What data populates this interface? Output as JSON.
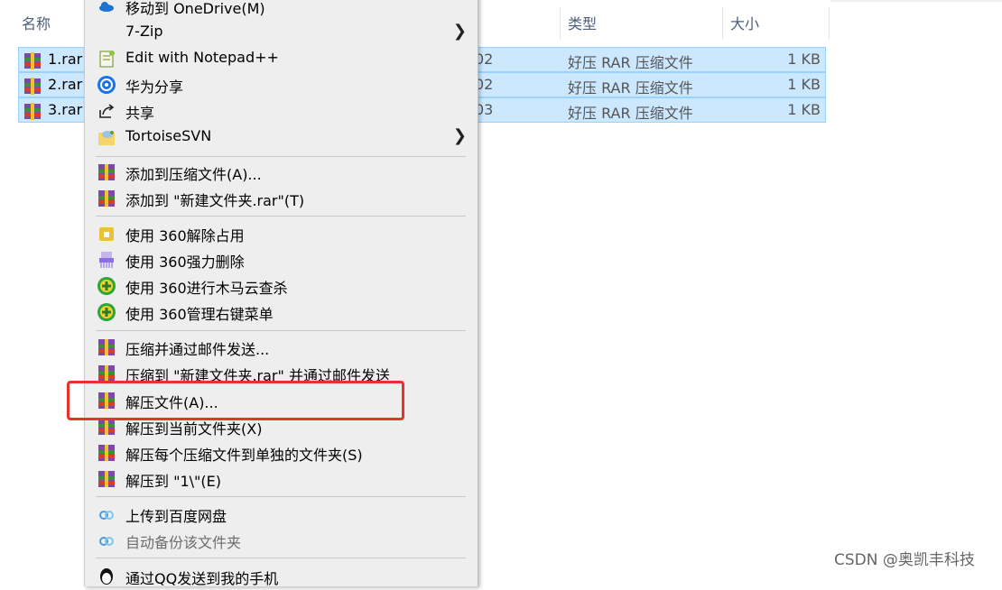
{
  "explorer": {
    "columns": {
      "name": "名称",
      "type": "类型",
      "size": "大小"
    },
    "files": [
      {
        "name": "1.rar",
        "date_fragment": "02",
        "type": "好压 RAR 压缩文件",
        "size": "1 KB"
      },
      {
        "name": "2.rar",
        "date_fragment": "02",
        "type": "好压 RAR 压缩文件",
        "size": "1 KB"
      },
      {
        "name": "3.rar",
        "date_fragment": "03",
        "type": "好压 RAR 压缩文件",
        "size": "1 KB"
      }
    ]
  },
  "context_menu": {
    "onedrive": "移动到 OneDrive(M)",
    "sevenzip": "7-Zip",
    "notepadpp": "Edit with Notepad++",
    "huawei_share": "华为分享",
    "share": "共享",
    "tortoisesvn": "TortoiseSVN",
    "add_archive": "添加到压缩文件(A)...",
    "add_to_named": "添加到 \"新建文件夹.rar\"(T)",
    "unlock_360": "使用 360解除占用",
    "force_delete_360": "使用 360强力删除",
    "trojan_scan_360": "使用 360进行木马云查杀",
    "manage_menu_360": "使用 360管理右键菜单",
    "compress_email": "压缩并通过邮件发送...",
    "compress_named_email": "压缩到 \"新建文件夹.rar\" 并通过邮件发送",
    "extract_files": "解压文件(A)...",
    "extract_here": "解压到当前文件夹(X)",
    "extract_each": "解压每个压缩文件到单独的文件夹(S)",
    "extract_to_1": "解压到 \"1\\\"(E)",
    "upload_baidu": "上传到百度网盘",
    "auto_backup": "自动备份该文件夹",
    "send_qq": "通过QQ发送到我的手机"
  },
  "watermark": "CSDN @奥凯丰科技",
  "colors": {
    "selection": "#cce8ff",
    "highlight_box": "#e8322c",
    "menu_bg": "#eeeeee"
  }
}
